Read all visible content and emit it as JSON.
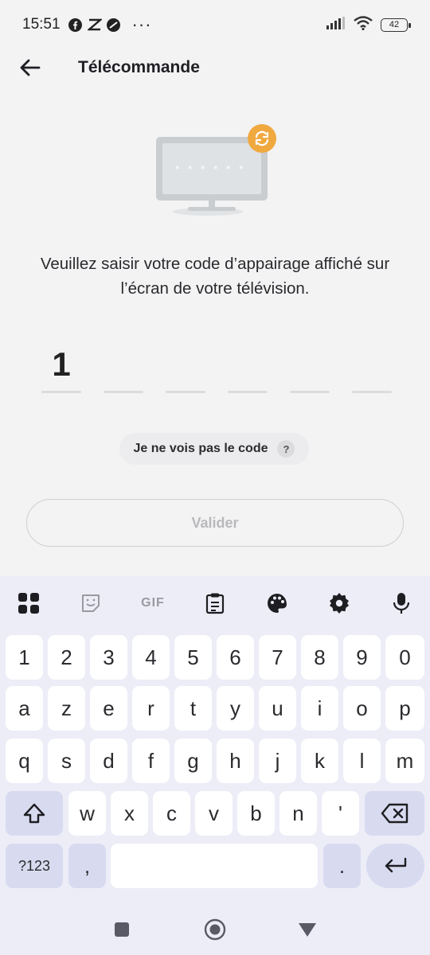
{
  "status_bar": {
    "time": "15:51",
    "dots": "···",
    "battery": "42",
    "left_icons": [
      "facebook-icon",
      "capcut-icon",
      "app-icon"
    ],
    "right_icons": [
      "signal-icon",
      "wifi-icon",
      "battery-icon"
    ]
  },
  "app_bar": {
    "title": "Télécommande",
    "back_icon": "arrow-left-icon"
  },
  "instruction": "Veuillez saisir votre code d’appairage affiché sur l’écran de votre télévision.",
  "code": {
    "digits": [
      "1",
      "",
      "",
      "",
      "",
      ""
    ]
  },
  "help": {
    "label": "Je ne vois pas le code",
    "icon_text": "?"
  },
  "validate_label": "Valider",
  "keyboard": {
    "toolbar": {
      "gif_label": "GIF",
      "icons": [
        "apps-grid-icon",
        "sticker-icon",
        "gif-icon",
        "clipboard-icon",
        "palette-icon",
        "settings-icon",
        "microphone-icon"
      ]
    },
    "rows": [
      [
        "1",
        "2",
        "3",
        "4",
        "5",
        "6",
        "7",
        "8",
        "9",
        "0"
      ],
      [
        "a",
        "z",
        "e",
        "r",
        "t",
        "y",
        "u",
        "i",
        "o",
        "p"
      ],
      [
        "q",
        "s",
        "d",
        "f",
        "g",
        "h",
        "j",
        "k",
        "l",
        "m"
      ],
      [
        "w",
        "x",
        "c",
        "v",
        "b",
        "n",
        "'"
      ]
    ],
    "symbols_label": "?123",
    "comma": ",",
    "period": "."
  },
  "colors": {
    "background": "#f3f3f4",
    "accent_orange": "#f0a93f",
    "keyboard_bg": "#ecedf7",
    "func_key": "#d8dbf0"
  }
}
